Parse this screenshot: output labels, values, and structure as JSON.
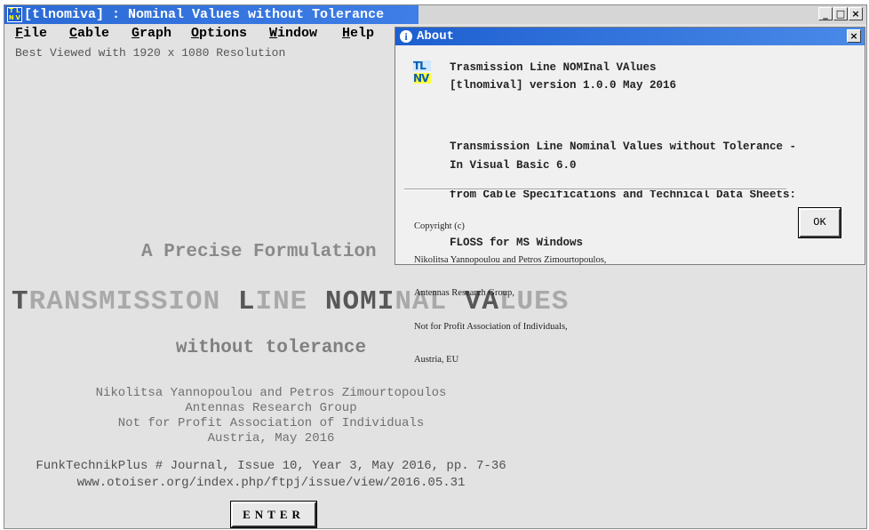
{
  "window": {
    "title": "[tlnomiva] : Nominal Values without Tolerance",
    "icon_name": "tlnv-app-icon",
    "controls": {
      "minimize": "_",
      "maximize": "□",
      "close": "×"
    }
  },
  "menu": [
    {
      "first": "F",
      "rest": "ile"
    },
    {
      "first": "C",
      "rest": "able"
    },
    {
      "first": "G",
      "rest": "raph"
    },
    {
      "first": "O",
      "rest": "ptions"
    },
    {
      "first": "W",
      "rest": "indow"
    },
    {
      "first": "H",
      "rest": "elp"
    }
  ],
  "main": {
    "resolution_note": "Best Viewed with 1920 x 1080 Resolution",
    "headline_precise": "A Precise Formulation",
    "headline": {
      "w1a": "T",
      "w1b": "RANSMISSION ",
      "w2a": "L",
      "w2b": "INE ",
      "w3a": "NOMI",
      "w3b": "NAL ",
      "w4a": "VA",
      "w4b": "LUES"
    },
    "subtitle": "without tolerance",
    "authors": "Nikolitsa Yannopoulou and Petros Zimourtopoulos",
    "group": "Antennas Research Group",
    "association": "Not for Profit Association of Individuals",
    "place_date": "Austria, May 2016",
    "journal": "FunkTechnikPlus # Journal, Issue 10, Year 3, May 2016, pp. 7-36",
    "url": "www.otoiser.org/index.php/ftpj/issue/view/2016.05.31",
    "enter_label": "ENTER"
  },
  "about": {
    "title": "About",
    "close": "×",
    "logo": {
      "line1": "TL",
      "line2": "NV"
    },
    "product_name": "Trasmission Line NOMInal VAlues",
    "version": "[tlnomival] version 1.0.0 May 2016",
    "desc1": "Transmission Line Nominal Values without Tolerance -",
    "desc2": "from Cable Specifications and Technical Data Sheets:",
    "desc3": "FLOSS for MS Windows",
    "language": "In Visual Basic 6.0",
    "copyright": "Copyright (c)",
    "copy_authors": "Nikolitsa Yannopoulou and Petros Zimourtopoulos,",
    "copy_group": "Antennas Research Group,",
    "copy_assoc": "Not for Profit Association of Individuals,",
    "copy_place": "Austria, EU",
    "ok_label": "OK"
  }
}
